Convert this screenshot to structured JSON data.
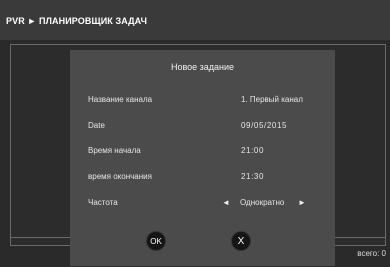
{
  "header": {
    "title": "PVR ► ПЛАНИРОВЩИК ЗАДАЧ"
  },
  "background": {
    "total_label": "всего: 0"
  },
  "dialog": {
    "title": "Новое задание",
    "fields": [
      {
        "label": "Название канала",
        "value": "1. Первый канал"
      },
      {
        "label": "Date",
        "value": "09/05/2015"
      },
      {
        "label": "Время начала",
        "value": "21:00"
      },
      {
        "label": "время окончания",
        "value": "21:30"
      }
    ],
    "frequency": {
      "label": "Частота",
      "value": "Однократно",
      "prev_arrow": "◄",
      "next_arrow": "►"
    },
    "buttons": {
      "ok": "OK",
      "cancel": "X"
    }
  },
  "colors": {
    "header_bg": "#3a3a3a",
    "dialog_bg": "#4b4b4b",
    "button_bg": "#151515"
  }
}
